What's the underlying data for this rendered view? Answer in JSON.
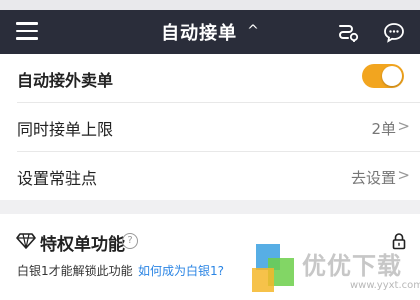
{
  "header": {
    "title": "自动接单",
    "caret": "^",
    "icons": [
      "menu-icon",
      "route-icon",
      "chat-icon"
    ]
  },
  "settings": {
    "auto_takeaway": {
      "label": "自动接外卖单",
      "enabled": true
    },
    "max_orders": {
      "label": "同时接单上限",
      "value": "2单",
      "chevron": ">"
    },
    "station": {
      "label": "设置常驻点",
      "value": "去设置",
      "chevron": ">"
    }
  },
  "privilege": {
    "title": "特权单功能",
    "help": "?",
    "note": "白银1才能解锁此功能",
    "link": "如何成为白银1?"
  },
  "watermark": {
    "text": "优优下载",
    "sub": "www.yyxt.com"
  },
  "colors": {
    "header_bg": "#2a2d3a",
    "toggle_on": "#f2a51f",
    "link": "#2b85e4"
  }
}
